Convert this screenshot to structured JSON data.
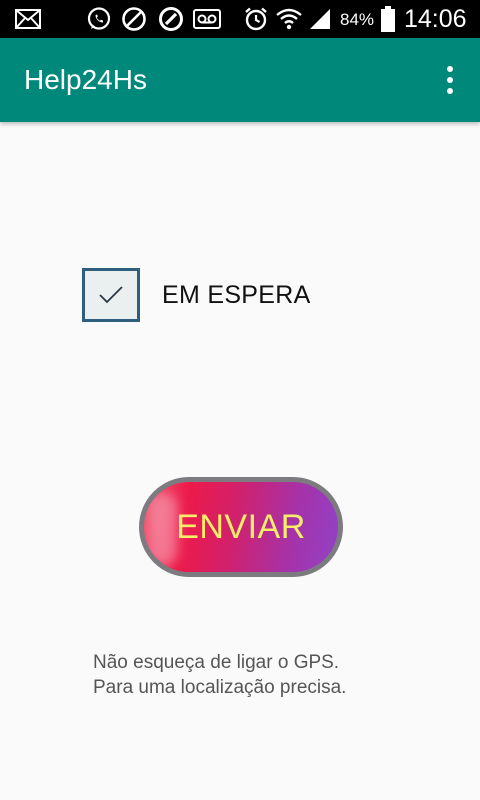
{
  "status_bar": {
    "battery": "84%",
    "time": "14:06"
  },
  "app_bar": {
    "title": "Help24Hs"
  },
  "checkbox": {
    "label": "EM ESPERA",
    "checked": true
  },
  "send_button": {
    "label": "ENVIAR"
  },
  "hint": {
    "line1": "Não esqueça de ligar o GPS.",
    "line2": "Para uma localização precisa."
  },
  "colors": {
    "app_bar": "#00897b",
    "checkbox_border": "#2f5f7f",
    "button_text": "#f4ee6a",
    "button_border": "#7c7c80"
  }
}
